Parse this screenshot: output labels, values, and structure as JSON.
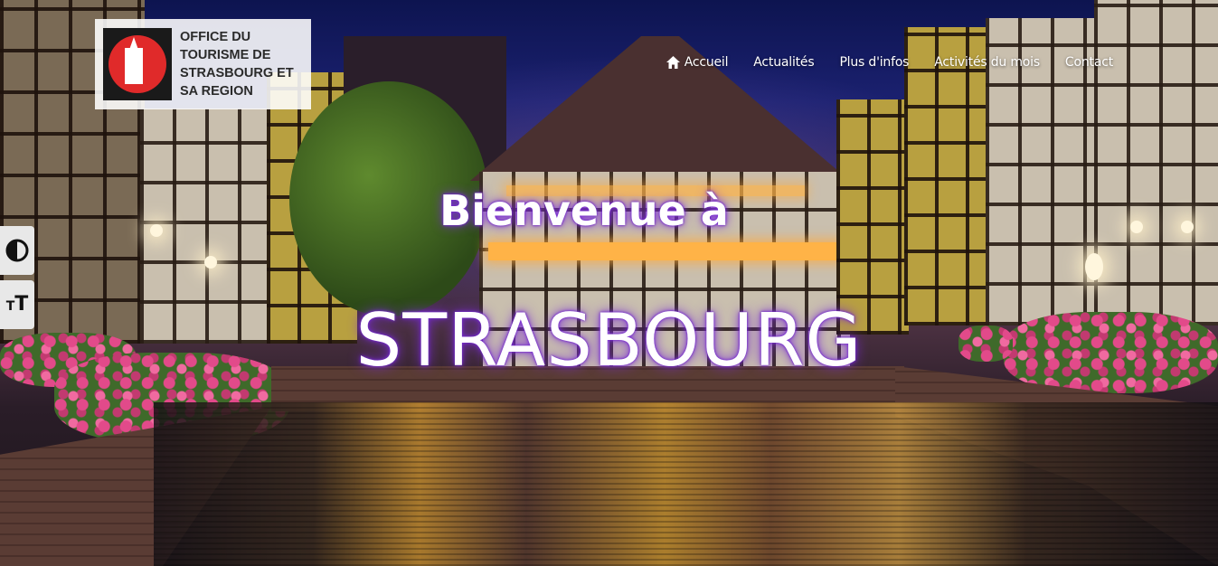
{
  "logo": {
    "text": "OFFICE DU TOURISME DE STRASBOURG ET SA REGION",
    "lines": [
      "OFFICE DU",
      "TOURISME DE",
      "STRASBOURG ET",
      "SA REGION"
    ]
  },
  "nav": {
    "items": [
      {
        "label": "Accueil",
        "icon": "home-icon"
      },
      {
        "label": "Actualités"
      },
      {
        "label": "Plus d'infos"
      },
      {
        "label": "Activités du mois"
      },
      {
        "label": "Contact"
      }
    ]
  },
  "accessibility": {
    "contrast_icon": "contrast-icon",
    "text_size_icon": "text-size-icon"
  },
  "hero": {
    "welcome": "Bienvenue à",
    "city": "STRASBOURG",
    "glow_color": "#7a2cd6"
  }
}
